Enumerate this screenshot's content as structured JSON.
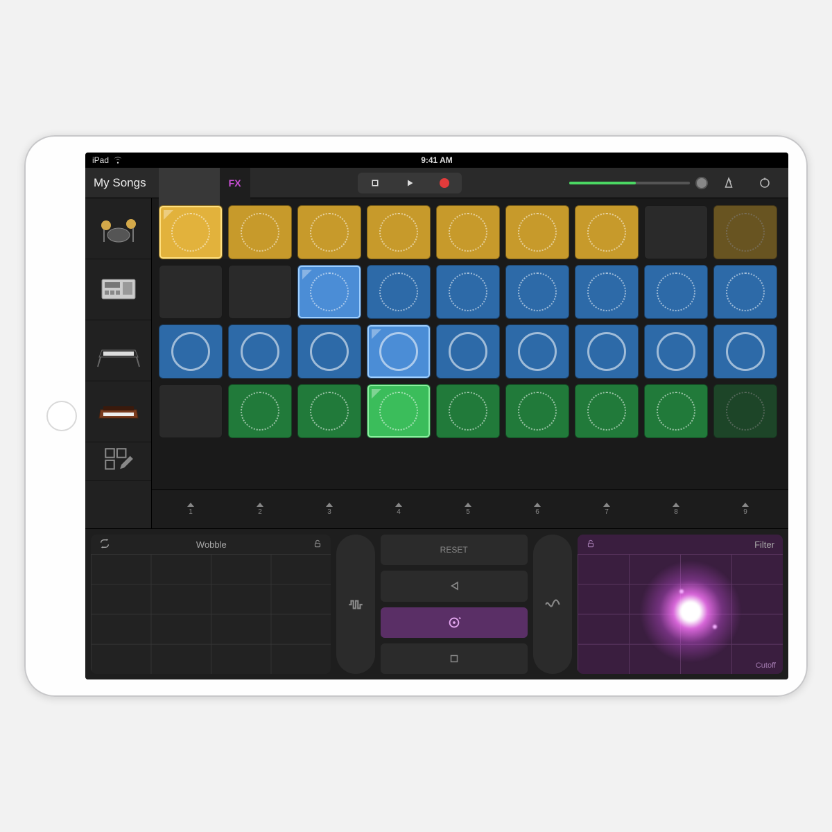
{
  "status": {
    "device": "iPad",
    "time": "9:41 AM"
  },
  "toolbar": {
    "library": "My Songs",
    "fx_label": "FX"
  },
  "volume_pct": 55,
  "tracks": [
    {
      "name": "drums"
    },
    {
      "name": "sampler"
    },
    {
      "name": "keyboard"
    },
    {
      "name": "synth"
    }
  ],
  "grid": {
    "cols": 9,
    "rows": [
      {
        "color": "yellow",
        "cells": [
          "active",
          "y",
          "y",
          "y",
          "y",
          "y",
          "y",
          "",
          "dim"
        ]
      },
      {
        "color": "blue",
        "cells": [
          "",
          "",
          "act",
          "b",
          "b",
          "b",
          "b",
          "b",
          "b"
        ]
      },
      {
        "color": "blue",
        "cells": [
          "b",
          "b",
          "b",
          "act",
          "b",
          "b",
          "b",
          "b",
          "b"
        ]
      },
      {
        "color": "green",
        "cells": [
          "",
          "g",
          "g",
          "act",
          "g",
          "g",
          "g",
          "g",
          "dim"
        ]
      }
    ]
  },
  "triggers": [
    "1",
    "2",
    "3",
    "4",
    "5",
    "6",
    "7",
    "8",
    "9"
  ],
  "fx": {
    "left_label": "Wobble",
    "right_label": "Filter",
    "reset": "RESET",
    "cutoff": "Cutoff"
  }
}
